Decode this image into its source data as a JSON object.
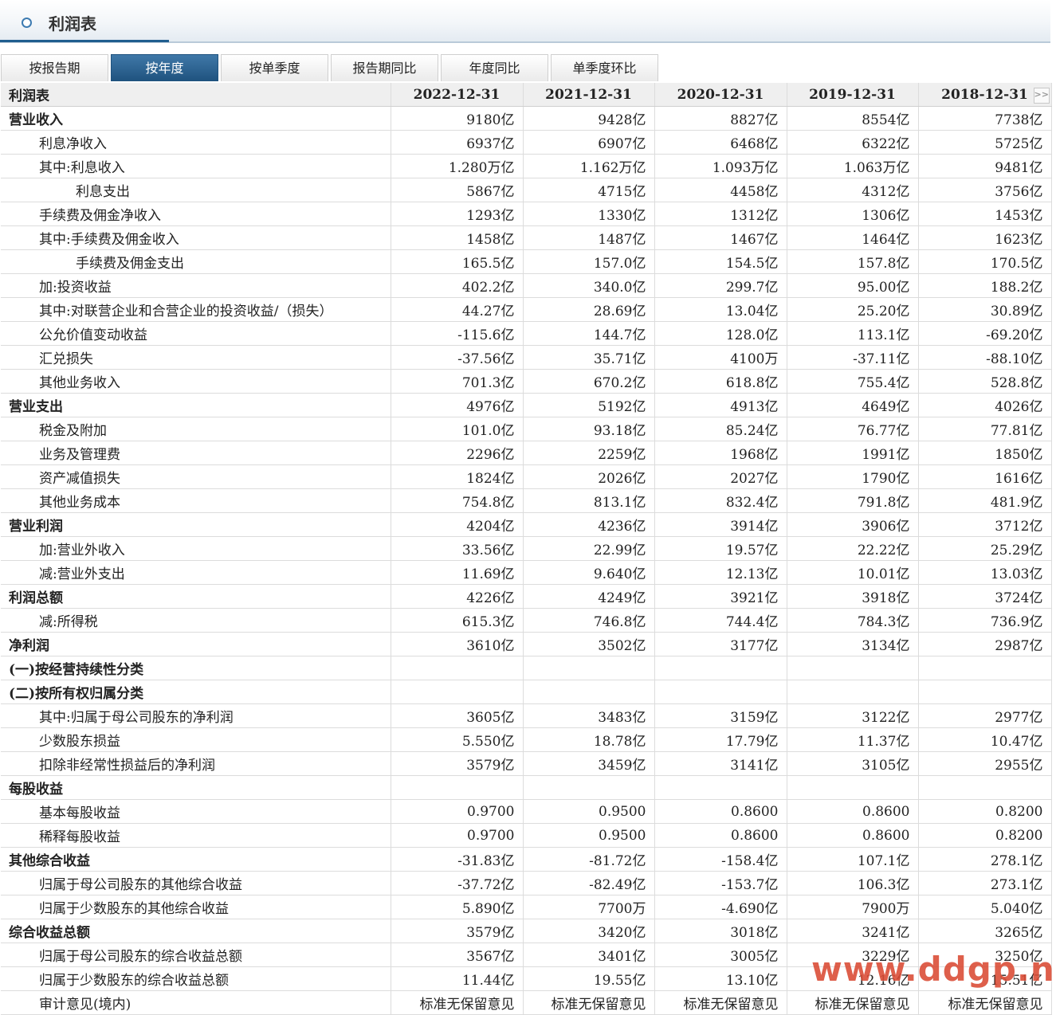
{
  "page": {
    "title": "利润表"
  },
  "tabs": [
    "按报告期",
    "按年度",
    "按单季度",
    "报告期同比",
    "年度同比",
    "单季度环比"
  ],
  "active_tab": 1,
  "table": {
    "header_label": "利润表",
    "columns": [
      "2022-12-31",
      "2021-12-31",
      "2020-12-31",
      "2019-12-31",
      "2018-12-31"
    ],
    "more_icon": ">>",
    "rows": [
      {
        "label": "营业收入",
        "level": 0,
        "values": [
          "9180亿",
          "9428亿",
          "8827亿",
          "8554亿",
          "7738亿"
        ]
      },
      {
        "label": "利息净收入",
        "level": 1,
        "values": [
          "6937亿",
          "6907亿",
          "6468亿",
          "6322亿",
          "5725亿"
        ]
      },
      {
        "label": "其中:利息收入",
        "level": 1,
        "values": [
          "1.280万亿",
          "1.162万亿",
          "1.093万亿",
          "1.063万亿",
          "9481亿"
        ]
      },
      {
        "label": "利息支出",
        "level": 2,
        "values": [
          "5867亿",
          "4715亿",
          "4458亿",
          "4312亿",
          "3756亿"
        ]
      },
      {
        "label": "手续费及佣金净收入",
        "level": 1,
        "values": [
          "1293亿",
          "1330亿",
          "1312亿",
          "1306亿",
          "1453亿"
        ]
      },
      {
        "label": "其中:手续费及佣金收入",
        "level": 1,
        "values": [
          "1458亿",
          "1487亿",
          "1467亿",
          "1464亿",
          "1623亿"
        ]
      },
      {
        "label": "手续费及佣金支出",
        "level": 2,
        "values": [
          "165.5亿",
          "157.0亿",
          "154.5亿",
          "157.8亿",
          "170.5亿"
        ]
      },
      {
        "label": "加:投资收益",
        "level": 1,
        "values": [
          "402.2亿",
          "340.0亿",
          "299.7亿",
          "95.00亿",
          "188.2亿"
        ]
      },
      {
        "label": "其中:对联营企业和合营企业的投资收益/（损失）",
        "level": 1,
        "values": [
          "44.27亿",
          "28.69亿",
          "13.04亿",
          "25.20亿",
          "30.89亿"
        ]
      },
      {
        "label": "公允价值变动收益",
        "level": 1,
        "values": [
          "-115.6亿",
          "144.7亿",
          "128.0亿",
          "113.1亿",
          "-69.20亿"
        ]
      },
      {
        "label": "汇兑损失",
        "level": 1,
        "values": [
          "-37.56亿",
          "35.71亿",
          "4100万",
          "-37.11亿",
          "-88.10亿"
        ]
      },
      {
        "label": "其他业务收入",
        "level": 1,
        "values": [
          "701.3亿",
          "670.2亿",
          "618.8亿",
          "755.4亿",
          "528.8亿"
        ]
      },
      {
        "label": "营业支出",
        "level": 0,
        "values": [
          "4976亿",
          "5192亿",
          "4913亿",
          "4649亿",
          "4026亿"
        ]
      },
      {
        "label": "税金及附加",
        "level": 1,
        "values": [
          "101.0亿",
          "93.18亿",
          "85.24亿",
          "76.77亿",
          "77.81亿"
        ]
      },
      {
        "label": "业务及管理费",
        "level": 1,
        "values": [
          "2296亿",
          "2259亿",
          "1968亿",
          "1991亿",
          "1850亿"
        ]
      },
      {
        "label": "资产减值损失",
        "level": 1,
        "values": [
          "1824亿",
          "2026亿",
          "2027亿",
          "1790亿",
          "1616亿"
        ]
      },
      {
        "label": "其他业务成本",
        "level": 1,
        "values": [
          "754.8亿",
          "813.1亿",
          "832.4亿",
          "791.8亿",
          "481.9亿"
        ]
      },
      {
        "label": "营业利润",
        "level": 0,
        "values": [
          "4204亿",
          "4236亿",
          "3914亿",
          "3906亿",
          "3712亿"
        ]
      },
      {
        "label": "加:营业外收入",
        "level": 1,
        "values": [
          "33.56亿",
          "22.99亿",
          "19.57亿",
          "22.22亿",
          "25.29亿"
        ]
      },
      {
        "label": "减:营业外支出",
        "level": 1,
        "values": [
          "11.69亿",
          "9.640亿",
          "12.13亿",
          "10.01亿",
          "13.03亿"
        ]
      },
      {
        "label": "利润总额",
        "level": 0,
        "values": [
          "4226亿",
          "4249亿",
          "3921亿",
          "3918亿",
          "3724亿"
        ]
      },
      {
        "label": "减:所得税",
        "level": 1,
        "values": [
          "615.3亿",
          "746.8亿",
          "744.4亿",
          "784.3亿",
          "736.9亿"
        ]
      },
      {
        "label": "净利润",
        "level": 0,
        "values": [
          "3610亿",
          "3502亿",
          "3177亿",
          "3134亿",
          "2987亿"
        ]
      },
      {
        "label": "(一)按经营持续性分类",
        "level": 0,
        "values": [
          "",
          "",
          "",
          "",
          ""
        ]
      },
      {
        "label": "(二)按所有权归属分类",
        "level": 0,
        "values": [
          "",
          "",
          "",
          "",
          ""
        ]
      },
      {
        "label": "其中:归属于母公司股东的净利润",
        "level": 1,
        "values": [
          "3605亿",
          "3483亿",
          "3159亿",
          "3122亿",
          "2977亿"
        ]
      },
      {
        "label": "少数股东损益",
        "level": 1,
        "values": [
          "5.550亿",
          "18.78亿",
          "17.79亿",
          "11.37亿",
          "10.47亿"
        ]
      },
      {
        "label": "扣除非经常性损益后的净利润",
        "level": 1,
        "values": [
          "3579亿",
          "3459亿",
          "3141亿",
          "3105亿",
          "2955亿"
        ]
      },
      {
        "label": "每股收益",
        "level": 0,
        "values": [
          "",
          "",
          "",
          "",
          ""
        ]
      },
      {
        "label": "基本每股收益",
        "level": 1,
        "values": [
          "0.9700",
          "0.9500",
          "0.8600",
          "0.8600",
          "0.8200"
        ]
      },
      {
        "label": "稀释每股收益",
        "level": 1,
        "values": [
          "0.9700",
          "0.9500",
          "0.8600",
          "0.8600",
          "0.8200"
        ]
      },
      {
        "label": "其他综合收益",
        "level": 0,
        "values": [
          "-31.83亿",
          "-81.72亿",
          "-158.4亿",
          "107.1亿",
          "278.1亿"
        ]
      },
      {
        "label": "归属于母公司股东的其他综合收益",
        "level": 1,
        "values": [
          "-37.72亿",
          "-82.49亿",
          "-153.7亿",
          "106.3亿",
          "273.1亿"
        ]
      },
      {
        "label": "归属于少数股东的其他综合收益",
        "level": 1,
        "values": [
          "5.890亿",
          "7700万",
          "-4.690亿",
          "7900万",
          "5.040亿"
        ]
      },
      {
        "label": "综合收益总额",
        "level": 0,
        "values": [
          "3579亿",
          "3420亿",
          "3018亿",
          "3241亿",
          "3265亿"
        ]
      },
      {
        "label": "归属于母公司股东的综合收益总额",
        "level": 1,
        "values": [
          "3567亿",
          "3401亿",
          "3005亿",
          "3229亿",
          "3250亿"
        ]
      },
      {
        "label": "归属于少数股东的综合收益总额",
        "level": 1,
        "values": [
          "11.44亿",
          "19.55亿",
          "13.10亿",
          "12.16亿",
          "15.51亿"
        ]
      },
      {
        "label": "审计意见(境内)",
        "level": 1,
        "values": [
          "标准无保留意见",
          "标准无保留意见",
          "标准无保留意见",
          "标准无保留意见",
          "标准无保留意见"
        ]
      }
    ]
  },
  "watermark": "www.ddgp.net"
}
